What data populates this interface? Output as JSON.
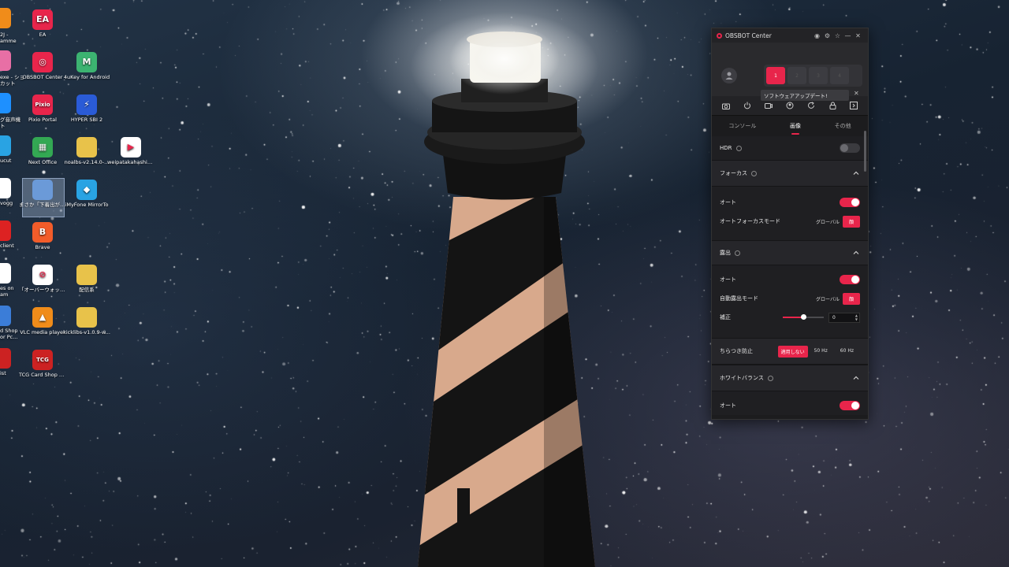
{
  "desktop": {
    "icons": [
      {
        "label": "EA",
        "color": "#e8254b",
        "glyph": "EA"
      },
      {
        "label": "OBSBOT Center",
        "color": "#e8254b",
        "glyph": "◎"
      },
      {
        "label": "4uKey for Android",
        "color": "#3cb371",
        "glyph": "M"
      },
      {
        "label": "Pixio Portal",
        "color": "#e8254b",
        "glyph": "Pixio"
      },
      {
        "label": "HYPER SBI 2",
        "color": "#2a5bd7",
        "glyph": "⚡"
      },
      {
        "label": "Next Office",
        "color": "#33a853",
        "glyph": "▦"
      },
      {
        "label": "noalbs-v2.14.0-...",
        "color": "#e8c24a",
        "glyph": ""
      },
      {
        "label": "weipatakahashi_...",
        "color": "#ffffff",
        "glyph": "▶"
      },
      {
        "label": "まさか「下着出が美女ですって...",
        "color": "#6b9ad8",
        "glyph": ""
      },
      {
        "label": "iMyFone MirrorTo",
        "color": "#29a3e3",
        "glyph": "◆"
      },
      {
        "label": "Brave",
        "color": "#f25c2a",
        "glyph": "B"
      },
      {
        "label": "「オーバーウォッチ 2」",
        "color": "#ffffff",
        "glyph": "⊘"
      },
      {
        "label": "配信系",
        "color": "#e8c24a",
        "glyph": ""
      },
      {
        "label": "VLC media player",
        "color": "#f08c1a",
        "glyph": "▲"
      },
      {
        "label": "kicklibs-v1.0.9-w...",
        "color": "#e8c24a",
        "glyph": ""
      },
      {
        "label": "TCG Card Shop Simulator",
        "color": "#c22",
        "glyph": "TCG"
      }
    ],
    "edge_labels": [
      "2J -",
      "amme",
      "exe - ショ",
      "カット",
      "グ音声機",
      "ト",
      "ucut",
      "vogg",
      "client",
      "es on",
      "am",
      "d Shop",
      "or Pc...",
      "ist"
    ]
  },
  "app": {
    "title": "OBSBOT Center",
    "title_buttons": [
      "◉",
      "⚙",
      "☆",
      "—",
      "✕"
    ],
    "camera_slots": [
      "1",
      "2",
      "3",
      "4"
    ],
    "update_notice": "ソフトウェアアップデート!",
    "update_close": "✕",
    "tabs": [
      "コンソール",
      "画像",
      "その他"
    ],
    "hdr_label": "HDR",
    "focus": {
      "section_label": "フォーカス",
      "auto_label": "オート",
      "mode_label": "オートフォーカスモード",
      "mode_options": [
        "グローバル",
        "顔"
      ]
    },
    "exposure": {
      "section_label": "露出",
      "auto_label": "オート",
      "mode_label": "自動露出モード",
      "mode_options": [
        "グローバル",
        "顔"
      ],
      "comp_label": "補正",
      "comp_value": "0",
      "comp_level": 0.5
    },
    "flicker": {
      "label": "ちらつき防止",
      "options": [
        "適用しない",
        "50 Hz",
        "60 Hz"
      ]
    },
    "white_balance": {
      "section_label": "ホワイトバランス",
      "auto_label": "オート"
    },
    "accent_color": "#e8254b"
  }
}
